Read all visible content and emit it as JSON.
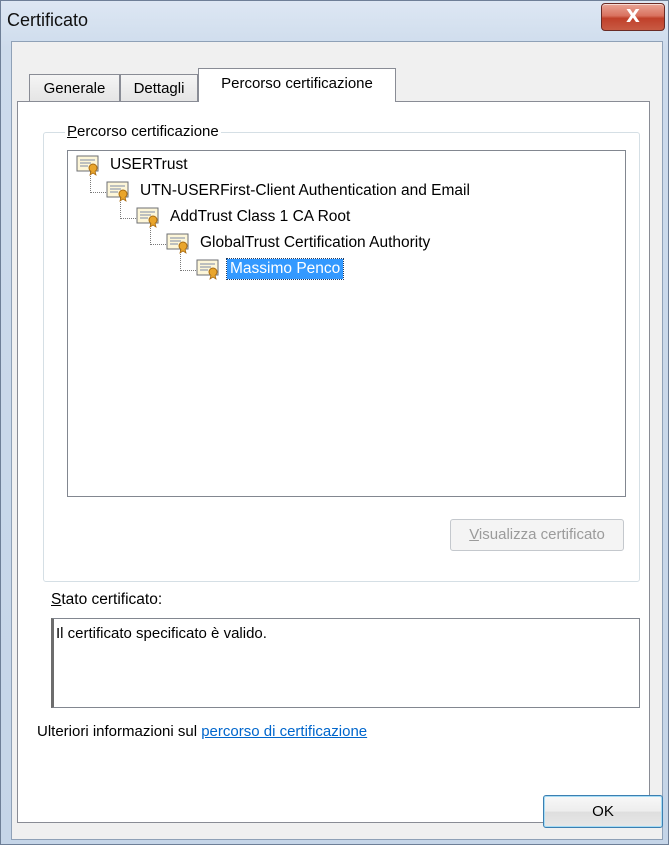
{
  "window": {
    "title": "Certificato",
    "close_glyph": "X"
  },
  "tabs": [
    {
      "label": "Generale",
      "active": false
    },
    {
      "label": "Dettagli",
      "active": false
    },
    {
      "label": "Percorso certificazione",
      "active": true
    }
  ],
  "path_group": {
    "label_accel": "P",
    "label_rest": "ercorso certificazione",
    "tree": [
      {
        "label": "USERTrust",
        "level": 0,
        "selected": false,
        "icon": "certificate-icon"
      },
      {
        "label": "UTN-USERFirst-Client Authentication and Email",
        "level": 1,
        "selected": false,
        "icon": "certificate-icon"
      },
      {
        "label": "AddTrust Class 1 CA Root",
        "level": 2,
        "selected": false,
        "icon": "certificate-icon"
      },
      {
        "label": "GlobalTrust Certification Authority",
        "level": 3,
        "selected": false,
        "icon": "certificate-icon"
      },
      {
        "label": "Massimo Penco",
        "level": 4,
        "selected": true,
        "icon": "certificate-icon"
      }
    ],
    "view_button_accel": "V",
    "view_button_rest": "isualizza certificato",
    "view_button_enabled": false
  },
  "status": {
    "label_accel": "S",
    "label_rest": "tato certificato:",
    "text": "Il certificato specificato è valido."
  },
  "info": {
    "prefix": "Ulteriori informazioni sul ",
    "link": "percorso di certificazione"
  },
  "ok_button": "OK",
  "colors": {
    "selection": "#3399ff",
    "link": "#0066cc"
  }
}
